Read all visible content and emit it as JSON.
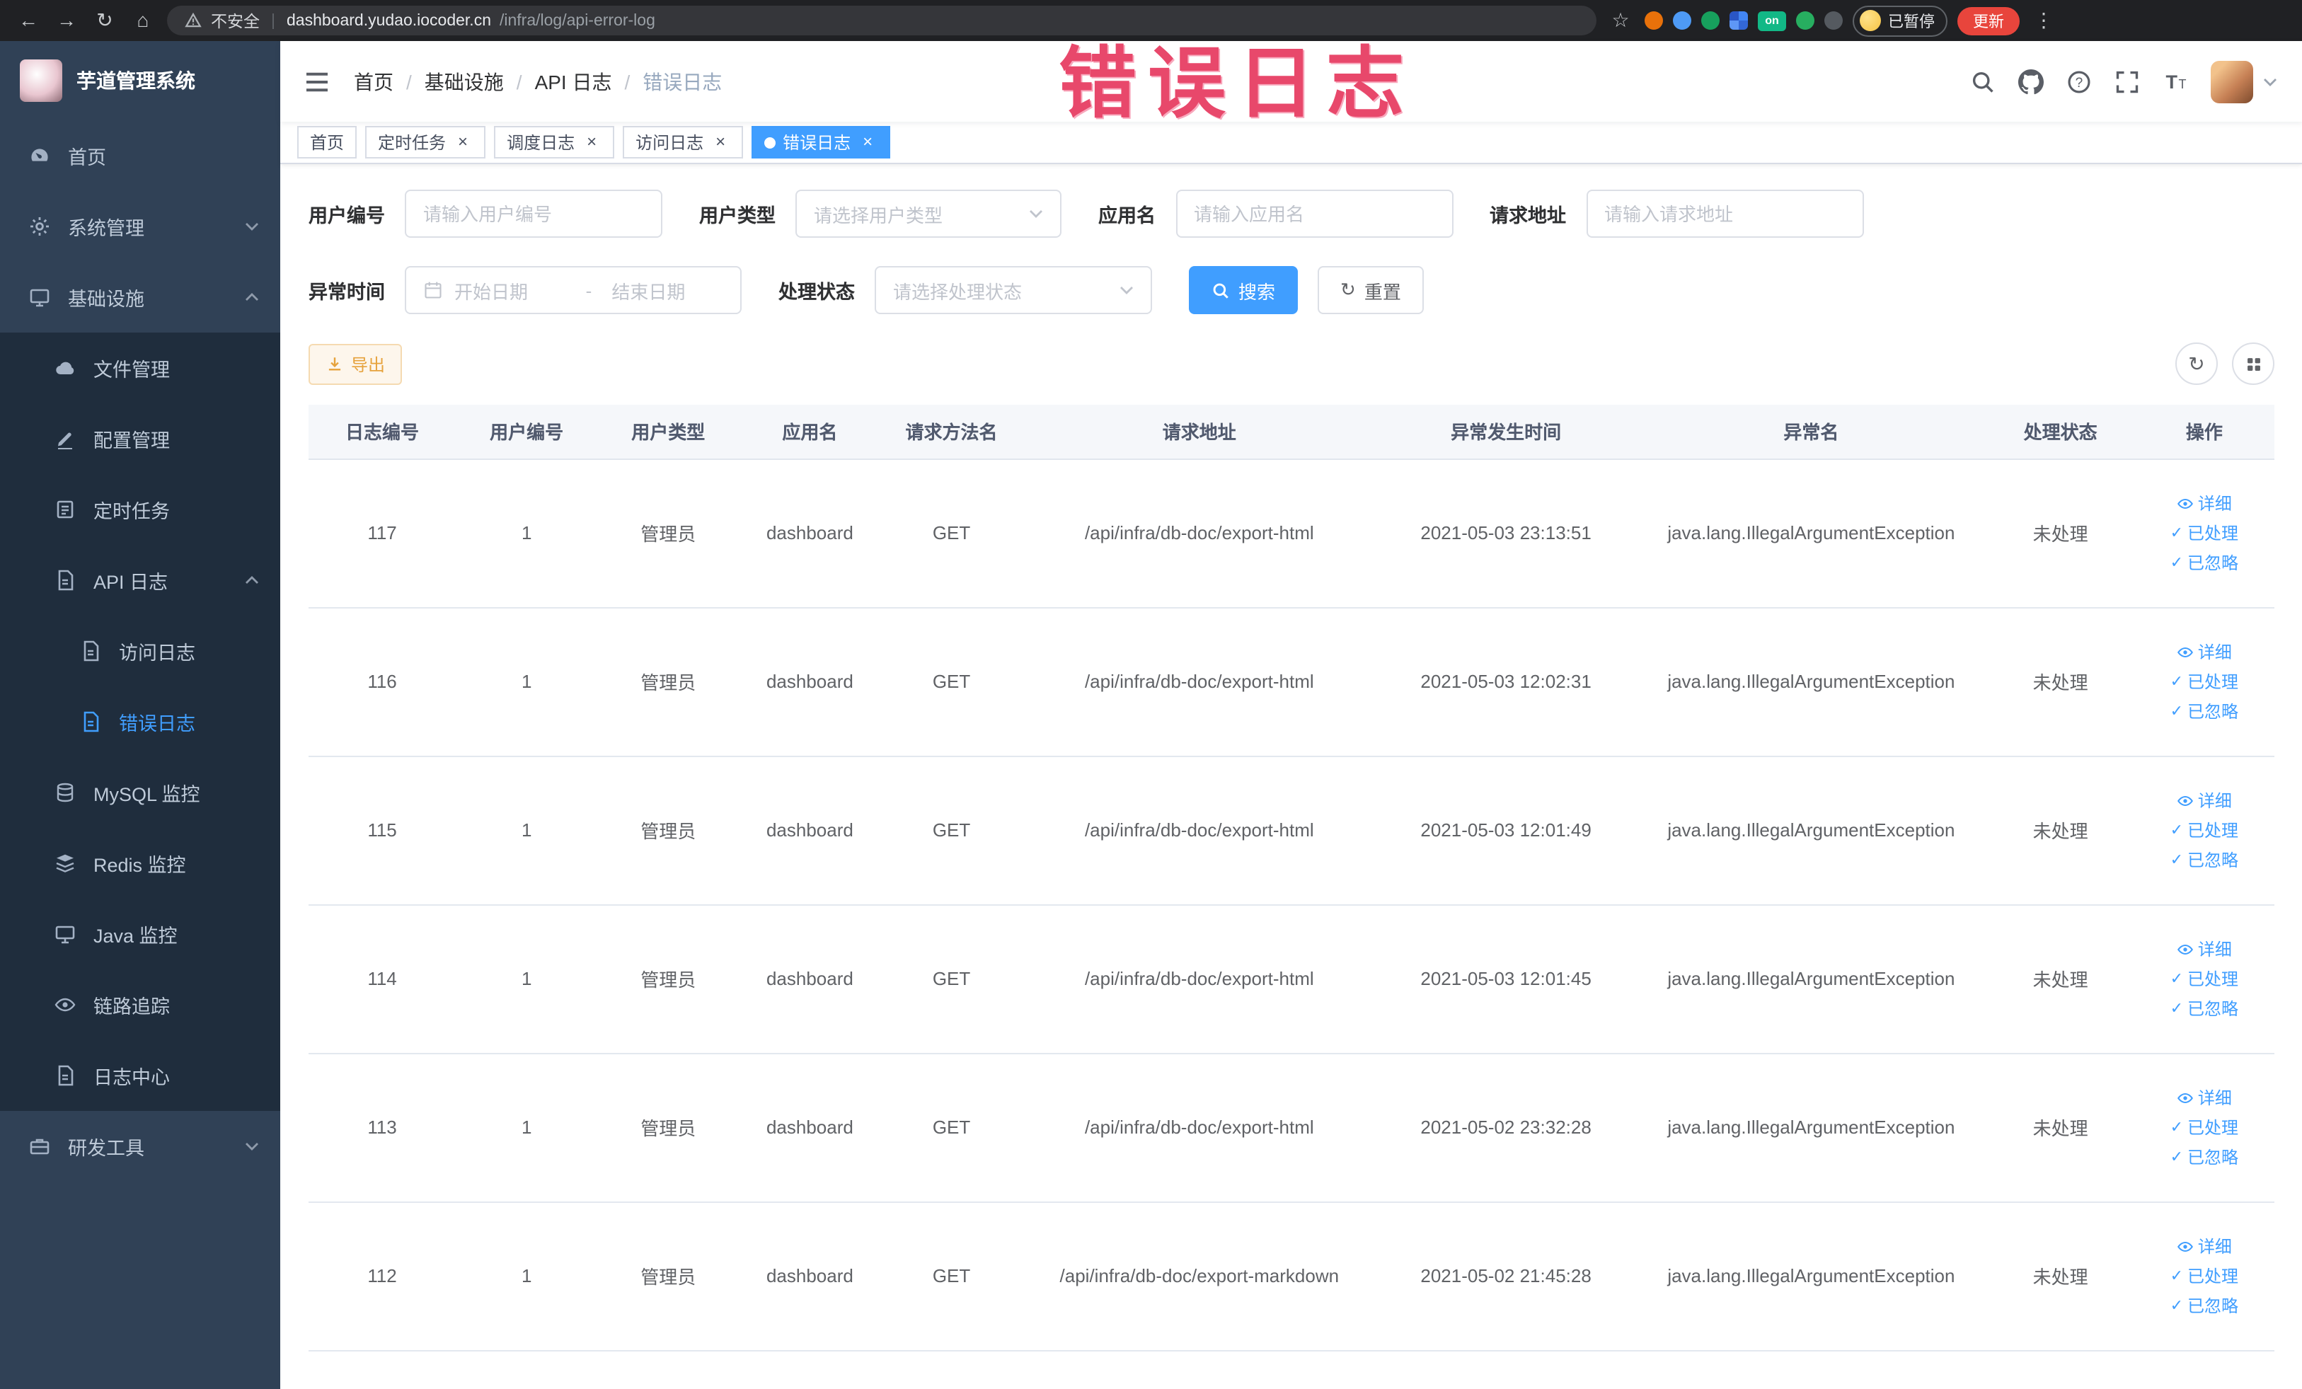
{
  "browser": {
    "security_label": "不安全",
    "url_separator": "|",
    "url_domain": "dashboard.yudao.iocoder.cn",
    "url_path": "/infra/log/api-error-log",
    "extension_badge": "on",
    "profile_label": "已暂停",
    "update_label": "更新"
  },
  "watermark_text": "错误日志",
  "icons": {
    "back": "←",
    "forward": "→",
    "refresh": "↻",
    "home": "⌂",
    "star": "☆",
    "dots": "⋮",
    "close": "×",
    "check": "✓"
  },
  "sidebar": {
    "logo_title": "芋道管理系统",
    "items": {
      "home": "首页",
      "system": "系统管理",
      "infra": "基础设施",
      "file": "文件管理",
      "config": "配置管理",
      "job": "定时任务",
      "api_log": "API 日志",
      "access_log": "访问日志",
      "error_log": "错误日志",
      "mysql": "MySQL 监控",
      "redis": "Redis 监控",
      "java": "Java 监控",
      "trace": "链路追踪",
      "log_center": "日志中心",
      "dev_tools": "研发工具"
    }
  },
  "breadcrumb": {
    "separator": "/",
    "items": [
      "首页",
      "基础设施",
      "API 日志",
      "错误日志"
    ]
  },
  "tabs": {
    "home": "首页",
    "job": "定时任务",
    "job_log": "调度日志",
    "access_log": "访问日志",
    "error_log": "错误日志"
  },
  "filters": {
    "user_id": {
      "label": "用户编号",
      "placeholder": "请输入用户编号"
    },
    "user_type": {
      "label": "用户类型",
      "placeholder": "请选择用户类型"
    },
    "app_name": {
      "label": "应用名",
      "placeholder": "请输入应用名"
    },
    "request_url": {
      "label": "请求地址",
      "placeholder": "请输入请求地址"
    },
    "exception_time": {
      "label": "异常时间",
      "start_placeholder": "开始日期",
      "range_separator": "-",
      "end_placeholder": "结束日期"
    },
    "process_status": {
      "label": "处理状态",
      "placeholder": "请选择处理状态"
    },
    "search_label": "搜索",
    "reset_label": "重置"
  },
  "toolbar": {
    "export_label": "导出"
  },
  "table": {
    "columns": [
      "日志编号",
      "用户编号",
      "用户类型",
      "应用名",
      "请求方法名",
      "请求地址",
      "异常发生时间",
      "异常名",
      "处理状态",
      "操作"
    ],
    "actions": {
      "detail": "详细",
      "processed": "已处理",
      "ignored": "已忽略"
    },
    "rows": [
      {
        "id": "117",
        "user_id": "1",
        "user_type": "管理员",
        "app": "dashboard",
        "method": "GET",
        "url": "/api/infra/db-doc/export-html",
        "time": "2021-05-03 23:13:51",
        "exception": "java.lang.IllegalArgumentException",
        "status": "未处理"
      },
      {
        "id": "116",
        "user_id": "1",
        "user_type": "管理员",
        "app": "dashboard",
        "method": "GET",
        "url": "/api/infra/db-doc/export-html",
        "time": "2021-05-03 12:02:31",
        "exception": "java.lang.IllegalArgumentException",
        "status": "未处理"
      },
      {
        "id": "115",
        "user_id": "1",
        "user_type": "管理员",
        "app": "dashboard",
        "method": "GET",
        "url": "/api/infra/db-doc/export-html",
        "time": "2021-05-03 12:01:49",
        "exception": "java.lang.IllegalArgumentException",
        "status": "未处理"
      },
      {
        "id": "114",
        "user_id": "1",
        "user_type": "管理员",
        "app": "dashboard",
        "method": "GET",
        "url": "/api/infra/db-doc/export-html",
        "time": "2021-05-03 12:01:45",
        "exception": "java.lang.IllegalArgumentException",
        "status": "未处理"
      },
      {
        "id": "113",
        "user_id": "1",
        "user_type": "管理员",
        "app": "dashboard",
        "method": "GET",
        "url": "/api/infra/db-doc/export-html",
        "time": "2021-05-02 23:32:28",
        "exception": "java.lang.IllegalArgumentException",
        "status": "未处理"
      },
      {
        "id": "112",
        "user_id": "1",
        "user_type": "管理员",
        "app": "dashboard",
        "method": "GET",
        "url": "/api/infra/db-doc/export-markdown",
        "time": "2021-05-02 21:45:28",
        "exception": "java.lang.IllegalArgumentException",
        "status": "未处理"
      }
    ]
  },
  "colors": {
    "primary": "#409EFF",
    "warning": "#e6a23c",
    "sidebar_bg": "#304156",
    "sidebar_sub_bg": "#1f2d3d",
    "watermark": "#e8486b",
    "browser_bar": "#202124"
  }
}
